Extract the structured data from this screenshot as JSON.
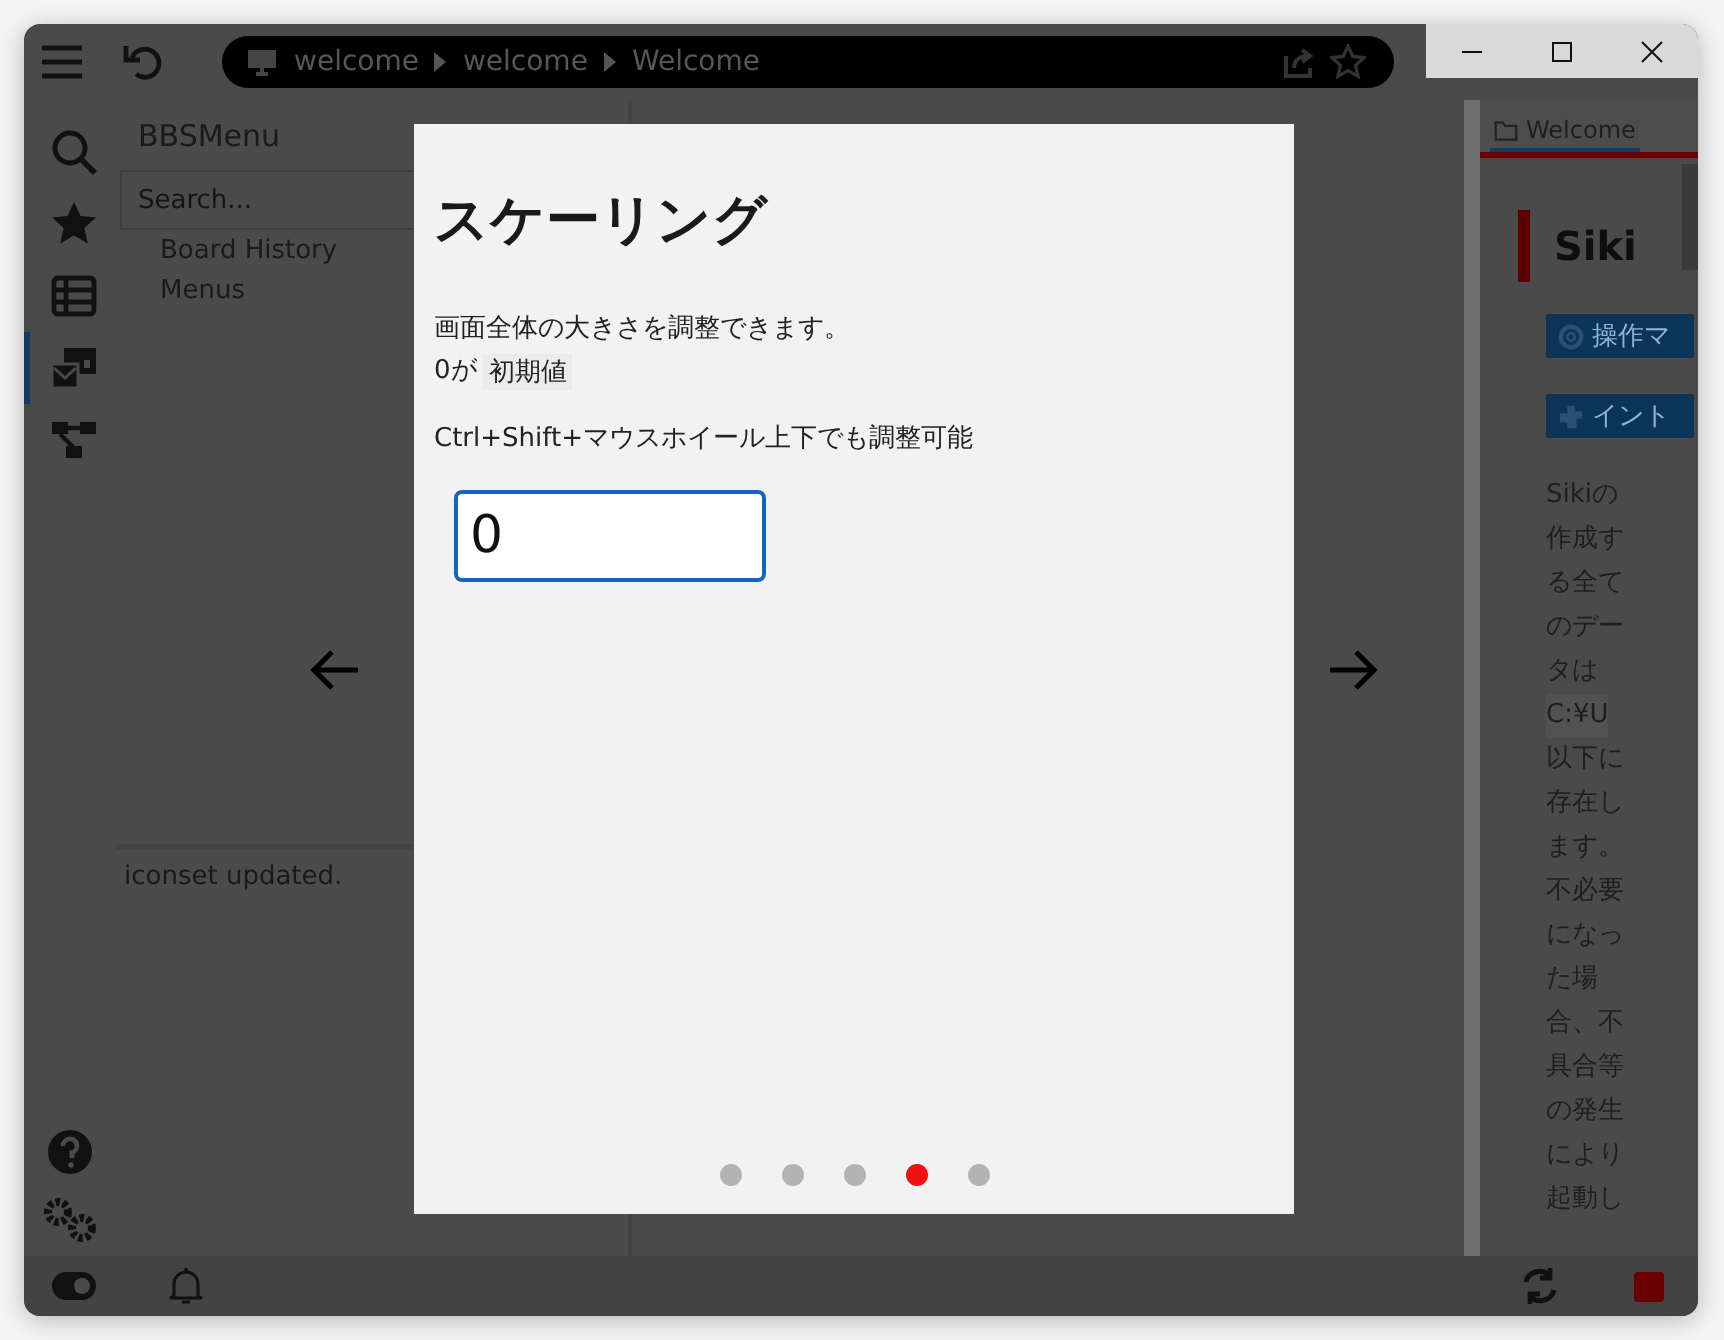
{
  "toolbar": {
    "breadcrumb": [
      "welcome",
      "welcome",
      "Welcome"
    ]
  },
  "activity_bar": [
    {
      "kind": "search",
      "selected": false
    },
    {
      "kind": "star",
      "selected": false
    },
    {
      "kind": "list",
      "selected": false
    },
    {
      "kind": "boards",
      "selected": true
    },
    {
      "kind": "tree",
      "selected": false
    }
  ],
  "sidebar": {
    "title": "BBSMenu",
    "search": {
      "placeholder": "Search..."
    },
    "items": [
      {
        "label": "Board History"
      },
      {
        "label": "Menus"
      }
    ],
    "log": "iconset updated."
  },
  "dialog": {
    "title": "スケーリング",
    "description": "画面全体の大きさを調整できます。",
    "default_note": {
      "prefix": "0が",
      "value": "初期値"
    },
    "hint": "Ctrl+Shift+マウスホイール上下でも調整可能",
    "input": {
      "value": "0"
    },
    "pages": [
      {
        "selected": false
      },
      {
        "selected": false
      },
      {
        "selected": false
      },
      {
        "selected": true
      },
      {
        "selected": false
      }
    ]
  },
  "right_panel": {
    "tab": {
      "label": "Welcome",
      "selected": true
    },
    "heading": "Siki",
    "buttons": [
      {
        "label": "操作マ",
        "kind": "help"
      },
      {
        "label": "イント",
        "kind": "puzzle"
      }
    ],
    "paragraph": [
      {
        "kind": "text",
        "text": "Sikiの作成する全てのデータは"
      },
      {
        "kind": "code",
        "text": "C:¥U"
      },
      {
        "kind": "text",
        "text": "以下に存在します。不必要になった場合、不具合等の発生により起動し"
      }
    ]
  }
}
